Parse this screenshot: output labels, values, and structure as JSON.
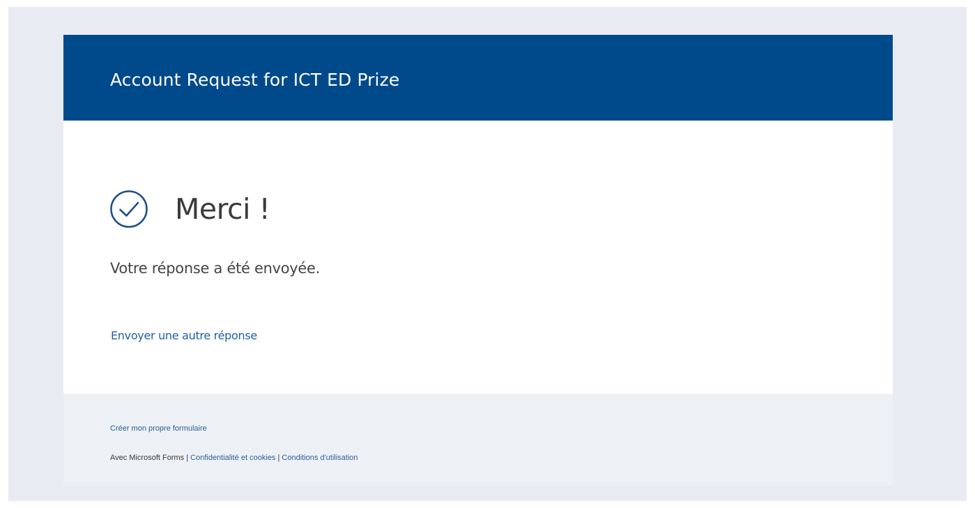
{
  "header": {
    "title": "Account Request for ICT ED Prize"
  },
  "confirmation": {
    "icon": "check-circle-icon",
    "heading": "Merci !",
    "message": "Votre réponse a été envoyée.",
    "another_response_link": "Envoyer une autre réponse"
  },
  "footer": {
    "create_form_link": "Créer mon propre formulaire",
    "powered_by": "Avec Microsoft Forms",
    "separator": " | ",
    "privacy_link": "Confidentialité et cookies",
    "terms_link": "Conditions d'utilisation"
  },
  "colors": {
    "header_bg": "#004a8c",
    "page_bg": "#e8ebf2",
    "link": "#1e5fa3",
    "icon": "#1f4e8a"
  }
}
